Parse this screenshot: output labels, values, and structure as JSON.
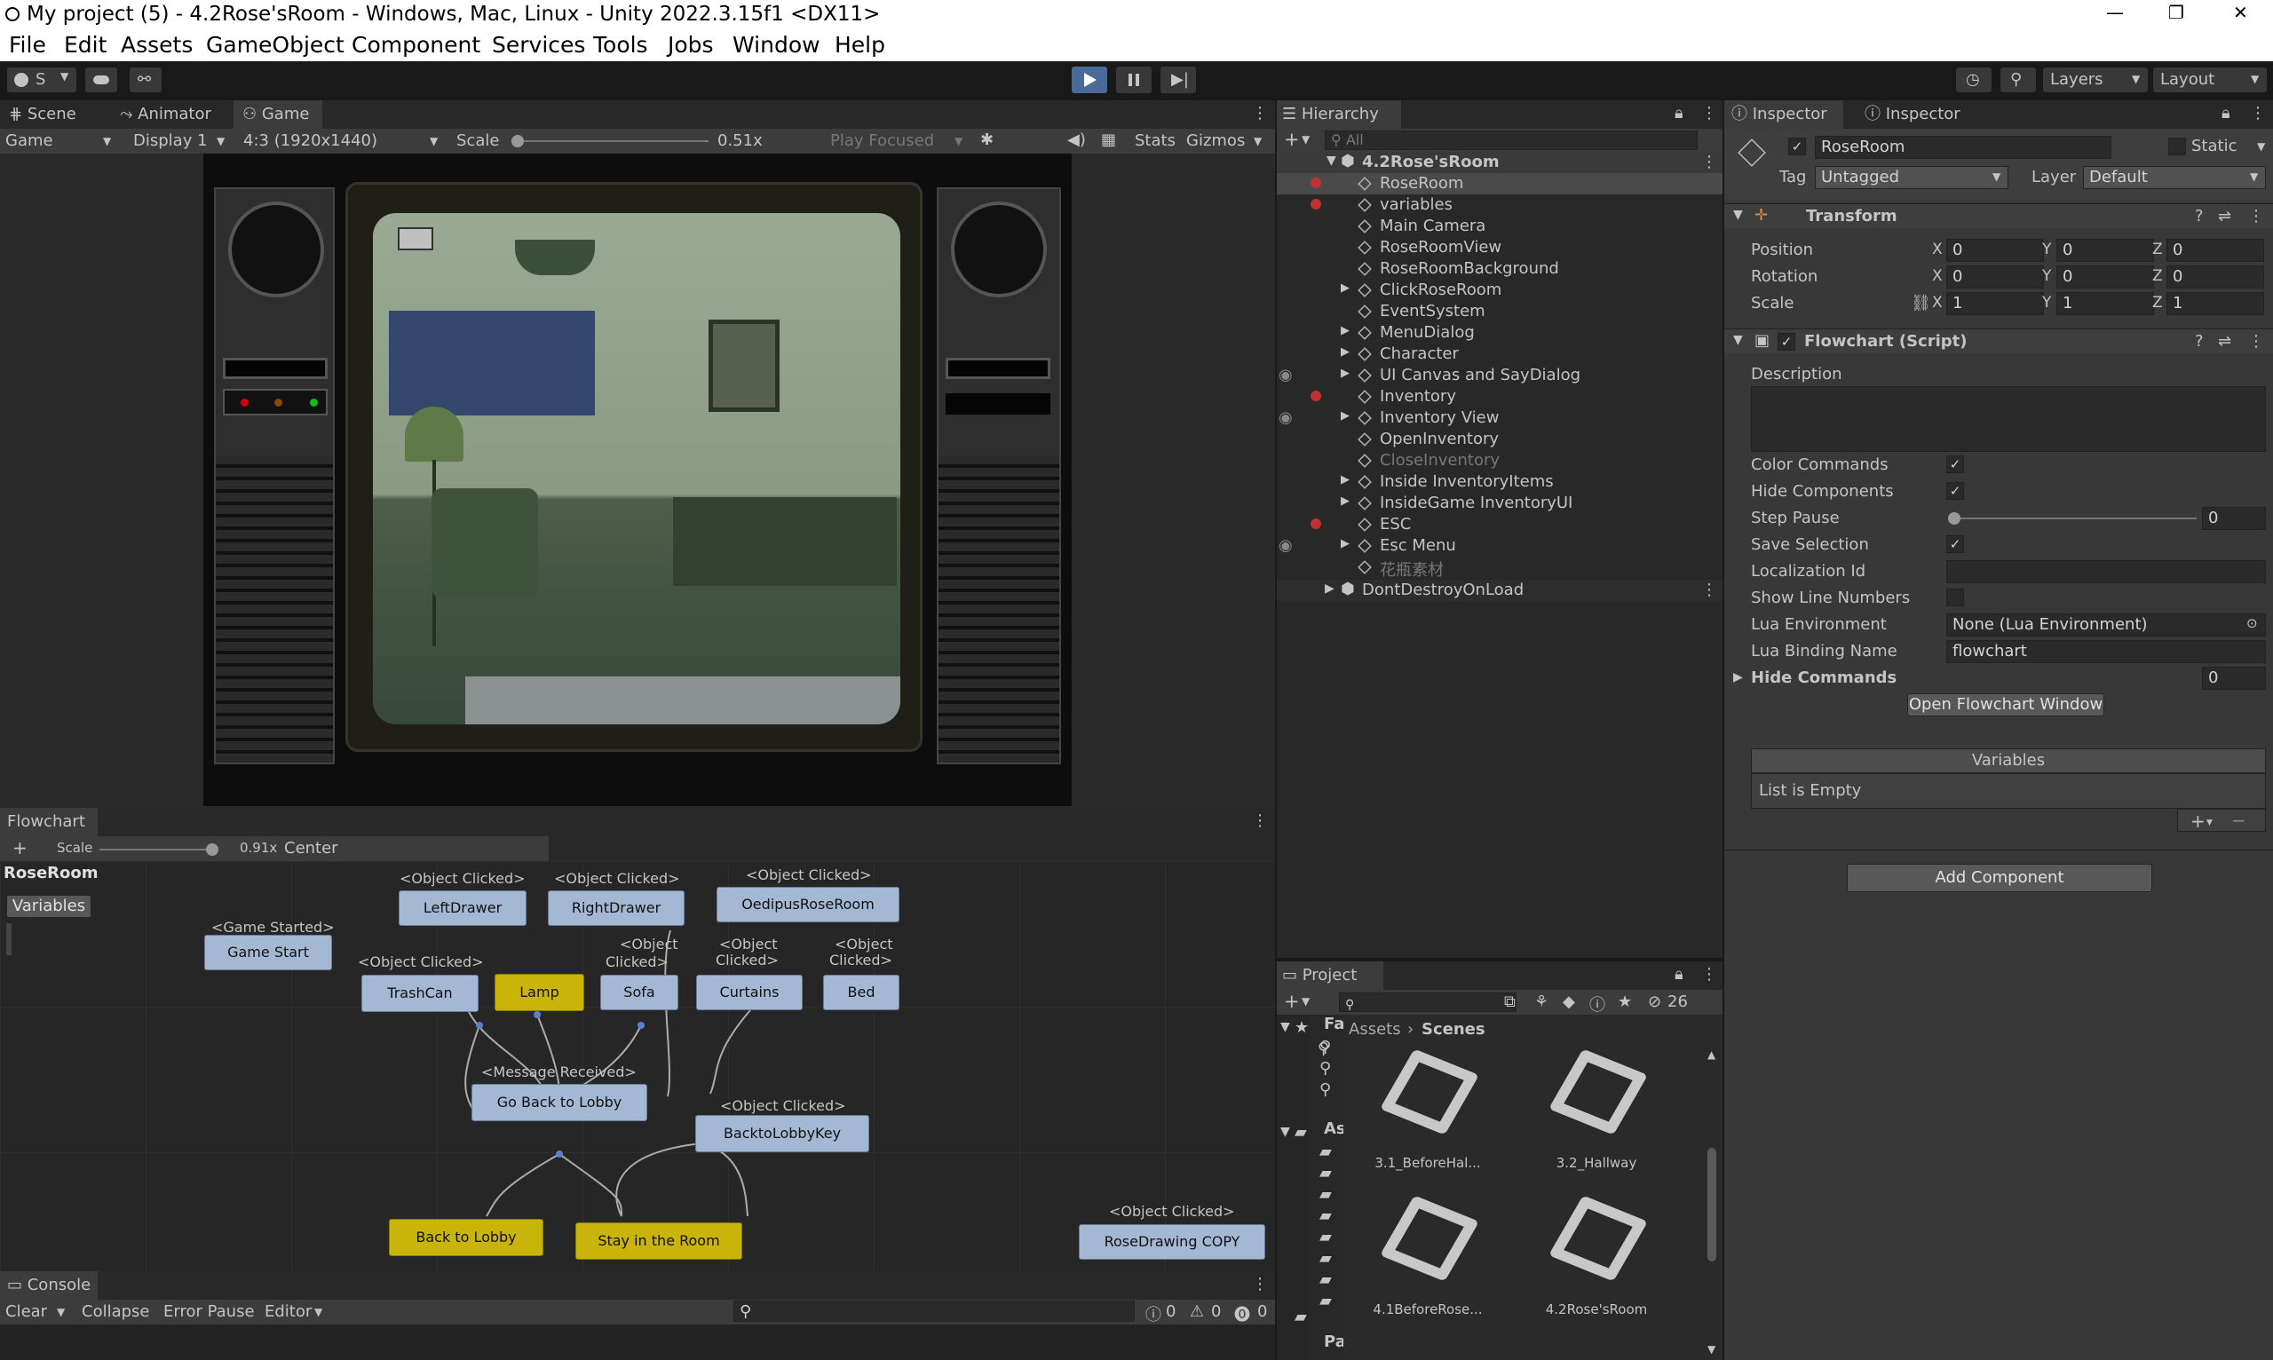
{
  "window": {
    "title": "My project (5) - 4.2Rose'sRoom - Windows, Mac, Linux - Unity 2022.3.15f1 <DX11>",
    "minimize": "—",
    "maximize": "❐",
    "close": "✕"
  },
  "menu": [
    "File",
    "Edit",
    "Assets",
    "GameObject",
    "Component",
    "Services",
    "Tools",
    "Jobs",
    "Window",
    "Help"
  ],
  "toolbar": {
    "account": "S",
    "layers": "Layers",
    "layout": "Layout"
  },
  "scene_tabs": {
    "scene": "Scene",
    "animator": "Animator",
    "game": "Game"
  },
  "game_bar": {
    "mode": "Game",
    "display": "Display 1",
    "aspect": "4:3 (1920x1440)",
    "scale_label": "Scale",
    "scale_value": "0.51x",
    "play_focused": "Play Focused",
    "stats": "Stats",
    "gizmos": "Gizmos"
  },
  "flowchart": {
    "tab": "Flowchart",
    "scale_label": "Scale",
    "scale_value": "0.91x",
    "center": "Center",
    "name": "RoseRoom",
    "variables_btn": "Variables",
    "labels": {
      "game_started": "<Game Started>",
      "obj1": "<Object Clicked>",
      "obj2": "<Object Clicked>",
      "obj3": "<Object Clicked>",
      "obj4": "<Object Clicked>",
      "obj5a": "<Object",
      "obj5b": "Clicked>",
      "obj6a": "<Object",
      "obj6b": "Clicked>",
      "obj7a": "<Object",
      "obj7b": "Clicked>",
      "msg": "<Message Received>",
      "obj8": "<Object Clicked>",
      "obj9": "<Object Clicked>"
    },
    "nodes": {
      "game_start": "Game Start",
      "left_drawer": "LeftDrawer",
      "right_drawer": "RightDrawer",
      "oedipus": "OedipusRoseRoom",
      "trashcan": "TrashCan",
      "lamp": "Lamp",
      "sofa": "Sofa",
      "curtains": "Curtains",
      "bed": "Bed",
      "go_back": "Go Back to Lobby",
      "backto_key": "BacktoLobbyKey",
      "back_lobby": "Back to Lobby",
      "stay": "Stay in the Room",
      "rosedrawing": "RoseDrawing COPY"
    }
  },
  "console": {
    "tab": "Console",
    "clear": "Clear",
    "collapse": "Collapse",
    "error_pause": "Error Pause",
    "editor": "Editor",
    "count_log": "0",
    "count_warn": "0",
    "count_err": "0"
  },
  "hierarchy": {
    "tab": "Hierarchy",
    "search_placeholder": "All",
    "scene": "4.2Rose'sRoom",
    "items": [
      "RoseRoom",
      "variables",
      "Main Camera",
      "RoseRoomView",
      "RoseRoomBackground",
      "ClickRoseRoom",
      "EventSystem",
      "MenuDialog",
      "Character",
      "UI Canvas and SayDialog",
      "Inventory",
      "Inventory View",
      "OpenInventory",
      "CloseInventory",
      "Inside InventoryItems",
      "InsideGame InventoryUI",
      "ESC",
      "Esc Menu",
      "花瓶素材"
    ],
    "dontdestroy": "DontDestroyOnLoad"
  },
  "project": {
    "tab": "Project",
    "fav": "Fa",
    "assets_short": "As",
    "packages_short": "Pa",
    "badge": "26",
    "breadcrumb_root": "Assets",
    "breadcrumb_leaf": "Scenes",
    "files": [
      "3.1_BeforeHal...",
      "3.2_Hallway",
      "4.1BeforeRose...",
      "4.2Rose'sRoom"
    ]
  },
  "inspector": {
    "tab1": "Inspector",
    "tab2": "Inspector",
    "object_name": "RoseRoom",
    "static": "Static",
    "tag_label": "Tag",
    "tag": "Untagged",
    "layer_label": "Layer",
    "layer": "Default",
    "transform": "Transform",
    "position": "Position",
    "rotation": "Rotation",
    "scale": "Scale",
    "pos": [
      "0",
      "0",
      "0"
    ],
    "rot": [
      "0",
      "0",
      "0"
    ],
    "scl": [
      "1",
      "1",
      "1"
    ],
    "axes": [
      "X",
      "Y",
      "Z"
    ],
    "flowchart_script": "Flowchart (Script)",
    "description": "Description",
    "color_commands": "Color Commands",
    "hide_components": "Hide Components",
    "step_pause": "Step Pause",
    "step_pause_value": "0",
    "save_selection": "Save Selection",
    "localization_id": "Localization Id",
    "show_line_numbers": "Show Line Numbers",
    "lua_env": "Lua Environment",
    "lua_env_value": "None (Lua Environment)",
    "lua_binding": "Lua Binding Name",
    "lua_binding_value": "flowchart",
    "hide_commands": "Hide Commands",
    "hide_commands_value": "0",
    "open_flowchart": "Open Flowchart Window",
    "variables": "Variables",
    "list_empty": "List is Empty",
    "add_component": "Add Component"
  }
}
